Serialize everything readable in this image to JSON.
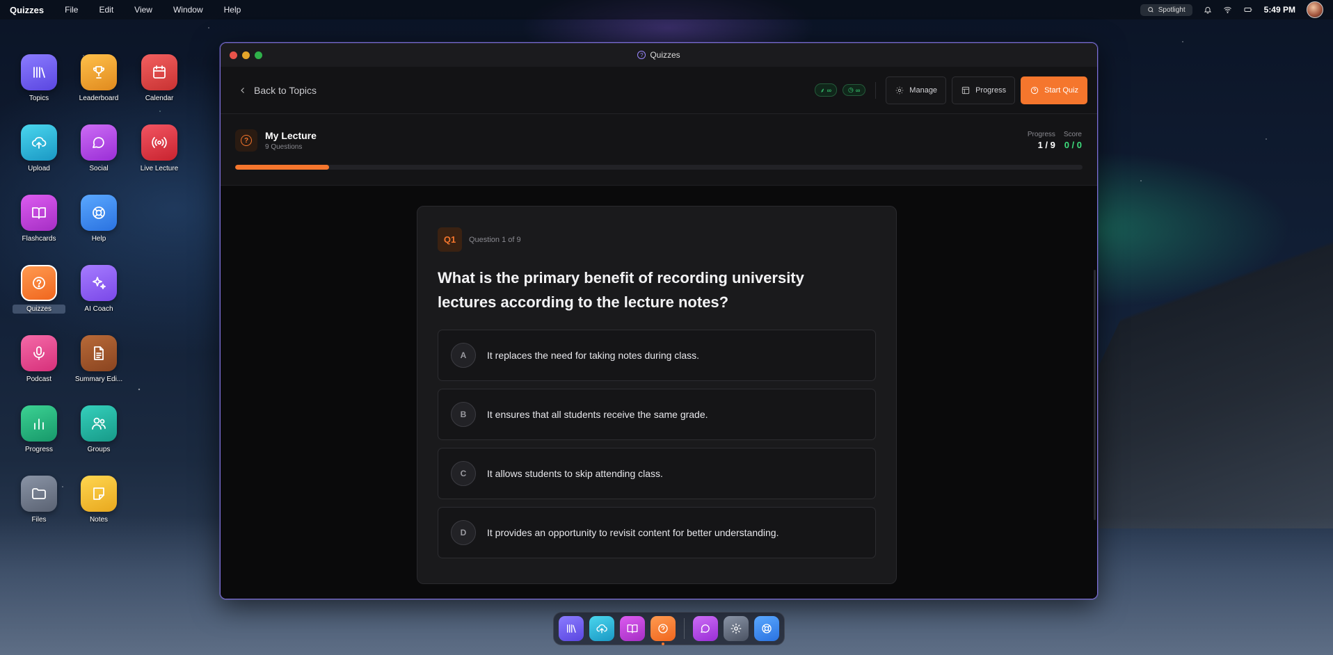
{
  "menubar": {
    "app_name": "Quizzes",
    "menus": [
      "File",
      "Edit",
      "View",
      "Window",
      "Help"
    ],
    "spotlight_label": "Spotlight",
    "clock": "5:49 PM"
  },
  "desktop_icons": [
    {
      "label": "Topics",
      "icon": "library-icon",
      "color": "#6a5cf0"
    },
    {
      "label": "Leaderboard",
      "icon": "trophy-icon",
      "color": "#f0a030"
    },
    {
      "label": "Calendar",
      "icon": "calendar-icon",
      "color": "#e04848"
    },
    {
      "label": "Upload",
      "icon": "cloud-upload-icon",
      "color": "#25b6d8"
    },
    {
      "label": "Social",
      "icon": "chat-icon",
      "color": "#b347e6"
    },
    {
      "label": "Live Lecture",
      "icon": "broadcast-icon",
      "color": "#e23b4a"
    },
    {
      "label": "Flashcards",
      "icon": "book-icon",
      "color": "#c23bd6"
    },
    {
      "label": "Help",
      "icon": "lifebuoy-icon",
      "color": "#3d8ef0"
    },
    {
      "label": "Quizzes",
      "icon": "question-icon",
      "color": "#f5762d"
    },
    {
      "label": "AI Coach",
      "icon": "sparkles-icon",
      "color": "#8b5cf6"
    },
    {
      "label": "Podcast",
      "icon": "microphone-icon",
      "color": "#e8468f"
    },
    {
      "label": "Summary Edi...",
      "icon": "document-icon",
      "color": "#a0582c"
    },
    {
      "label": "Progress",
      "icon": "bar-chart-icon",
      "color": "#20b37a"
    },
    {
      "label": "Groups",
      "icon": "users-icon",
      "color": "#1fb3a0"
    },
    {
      "label": "Files",
      "icon": "folder-icon",
      "color": "#6b7280"
    },
    {
      "label": "Notes",
      "icon": "note-icon",
      "color": "#f1c232"
    }
  ],
  "window": {
    "title": "Quizzes",
    "back_label": "Back to Topics",
    "pill1": "∞",
    "pill2": "∞",
    "manage_label": "Manage",
    "progress_label": "Progress",
    "start_label": "Start Quiz"
  },
  "quiz": {
    "title": "My Lecture",
    "subtitle": "9 Questions",
    "progress_key": "Progress",
    "progress_value": "1 / 9",
    "score_key": "Score",
    "score_value": "0 / 0",
    "progress_fraction": 0.111
  },
  "question": {
    "badge": "Q1",
    "count": "Question 1 of 9",
    "text": "What is the primary benefit of recording university lectures according to the lecture notes?",
    "options": [
      {
        "letter": "A",
        "text": "It replaces the need for taking notes during class."
      },
      {
        "letter": "B",
        "text": "It ensures that all students receive the same grade."
      },
      {
        "letter": "C",
        "text": "It allows students to skip attending class."
      },
      {
        "letter": "D",
        "text": "It provides an opportunity to revisit content for better understanding."
      }
    ]
  },
  "colors": {
    "accent": "#f5762d",
    "score_green": "#3ddc7c",
    "window_border": "#7d6fd8"
  }
}
